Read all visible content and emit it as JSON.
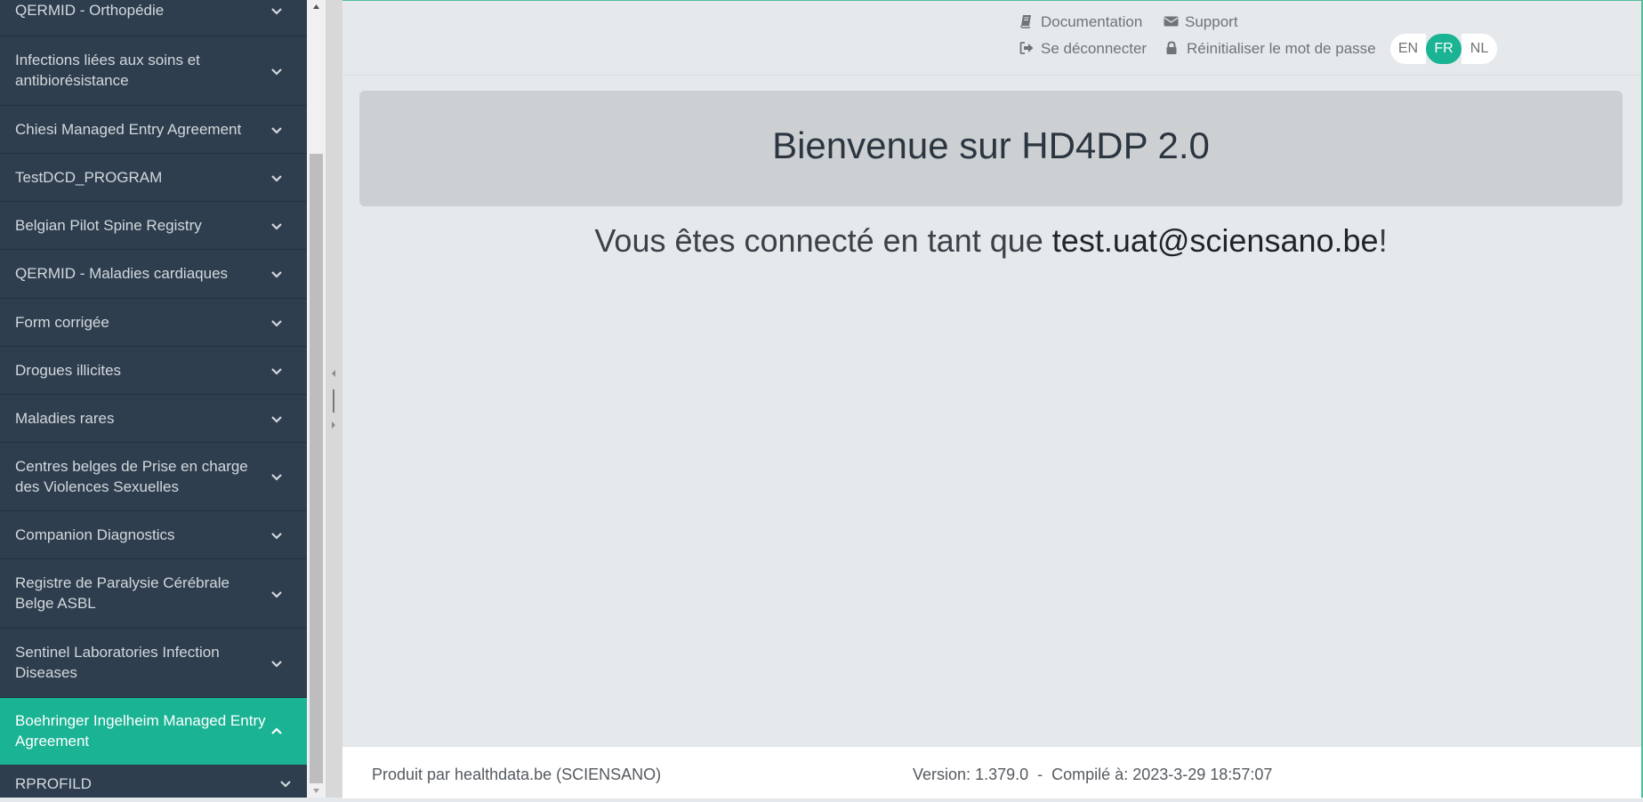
{
  "sidebar": {
    "items": [
      {
        "label": "QERMID - Orthopédie",
        "expanded": false
      },
      {
        "label": "Infections liées aux soins et antibiorésistance",
        "expanded": false
      },
      {
        "label": "Chiesi Managed Entry Agreement",
        "expanded": false
      },
      {
        "label": "TestDCD_PROGRAM",
        "expanded": false
      },
      {
        "label": "Belgian Pilot Spine Registry",
        "expanded": false
      },
      {
        "label": "QERMID - Maladies cardiaques",
        "expanded": false
      },
      {
        "label": "Form corrigée",
        "expanded": false
      },
      {
        "label": "Drogues illicites",
        "expanded": false
      },
      {
        "label": "Maladies rares",
        "expanded": false
      },
      {
        "label": "Centres belges de Prise en charge des Violences Sexuelles",
        "expanded": false
      },
      {
        "label": "Companion Diagnostics",
        "expanded": false
      },
      {
        "label": "Registre de Paralysie Cérébrale Belge ASBL",
        "expanded": false
      },
      {
        "label": "Sentinel Laboratories Infection Diseases",
        "expanded": false
      },
      {
        "label": "Boehringer Ingelheim Managed Entry Agreement",
        "expanded": true,
        "active": true
      },
      {
        "label": "RPROFILD",
        "expanded": false
      }
    ]
  },
  "header": {
    "documentation": "Documentation",
    "support": "Support",
    "logout": "Se déconnecter",
    "reset_password": "Réinitialiser le mot de passe",
    "languages": [
      "EN",
      "FR",
      "NL"
    ],
    "active_language": "FR"
  },
  "main": {
    "welcome_title": "Bienvenue sur HD4DP 2.0",
    "connected_prefix": "Vous êtes connecté en tant que ",
    "user_email": "test.uat@sciensano.be",
    "connected_suffix": "!"
  },
  "footer": {
    "produced_by": "Produit par healthdata.be (SCIENSANO)",
    "version_label": "Version:",
    "version": "1.379.0",
    "separator": "-",
    "compiled_label": "Compilé à:",
    "compiled_at": "2023-3-29 18:57:07"
  },
  "colors": {
    "sidebar_bg": "#2e3e4e",
    "accent": "#1ab394",
    "content_bg": "#e6e9ec",
    "jumbotron_bg": "#cdd0d3"
  }
}
